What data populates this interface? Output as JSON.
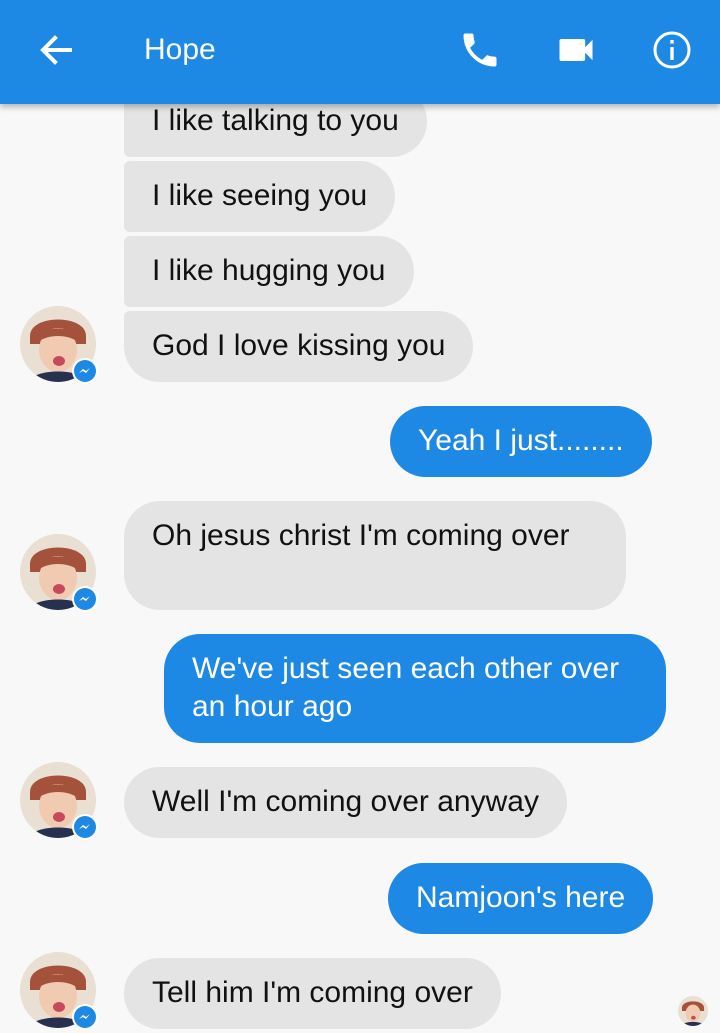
{
  "header": {
    "contact_name": "Hope",
    "background_color": "#1e88e5",
    "icons": [
      "back-arrow-icon",
      "phone-icon",
      "video-camera-icon",
      "info-icon"
    ]
  },
  "messages": [
    {
      "direction": "incoming",
      "text": "I like talking to you"
    },
    {
      "direction": "incoming",
      "text": "I like seeing you"
    },
    {
      "direction": "incoming",
      "text": "I like hugging you"
    },
    {
      "direction": "incoming",
      "text": "God I love kissing you"
    },
    {
      "direction": "outgoing",
      "text": "Yeah I just........"
    },
    {
      "direction": "incoming",
      "text": "Oh jesus christ I'm coming over"
    },
    {
      "direction": "outgoing",
      "text": "We've just seen each other over an hour ago"
    },
    {
      "direction": "incoming",
      "text": "Well I'm coming over anyway"
    },
    {
      "direction": "outgoing",
      "text": "Namjoon's here"
    },
    {
      "direction": "incoming",
      "text": "Tell him I'm coming over"
    }
  ],
  "colors": {
    "incoming_bubble": "#e4e4e4",
    "outgoing_bubble": "#1e88e5",
    "background": "#f8f8f8"
  }
}
